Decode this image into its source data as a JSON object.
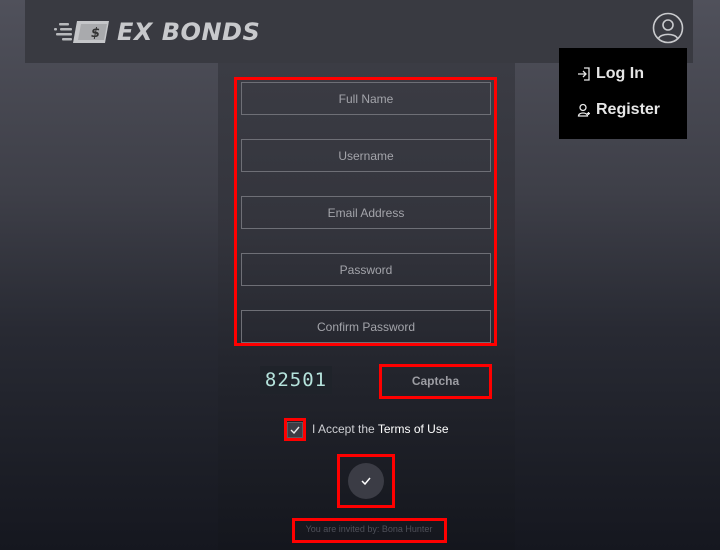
{
  "header": {
    "logo_text": "EX BONDS",
    "logo_icon": "money-bill-icon",
    "user_icon": "user-circle-icon"
  },
  "user_menu": {
    "items": [
      {
        "label": "Log In",
        "icon": "login-icon"
      },
      {
        "label": "Register",
        "icon": "user-add-icon"
      }
    ]
  },
  "form": {
    "fields": [
      {
        "name": "full-name",
        "placeholder": "Full Name",
        "value": ""
      },
      {
        "name": "username",
        "placeholder": "Username",
        "value": ""
      },
      {
        "name": "email",
        "placeholder": "Email Address",
        "value": ""
      },
      {
        "name": "password",
        "placeholder": "Password",
        "value": ""
      },
      {
        "name": "confirm-password",
        "placeholder": "Confirm Password",
        "value": ""
      }
    ],
    "captcha": {
      "code": "82501",
      "placeholder": "Captcha",
      "value": ""
    },
    "terms": {
      "prefix": "I Accept the ",
      "link": "Terms of Use",
      "checked": true
    },
    "submit_icon": "check-icon",
    "invite_text": "You are invited by: Bona Hunter"
  },
  "colors": {
    "highlight": "#ff0000",
    "header_bg": "#393a41",
    "menu_bg": "#000000",
    "captcha_text": "#b5e3dc"
  }
}
